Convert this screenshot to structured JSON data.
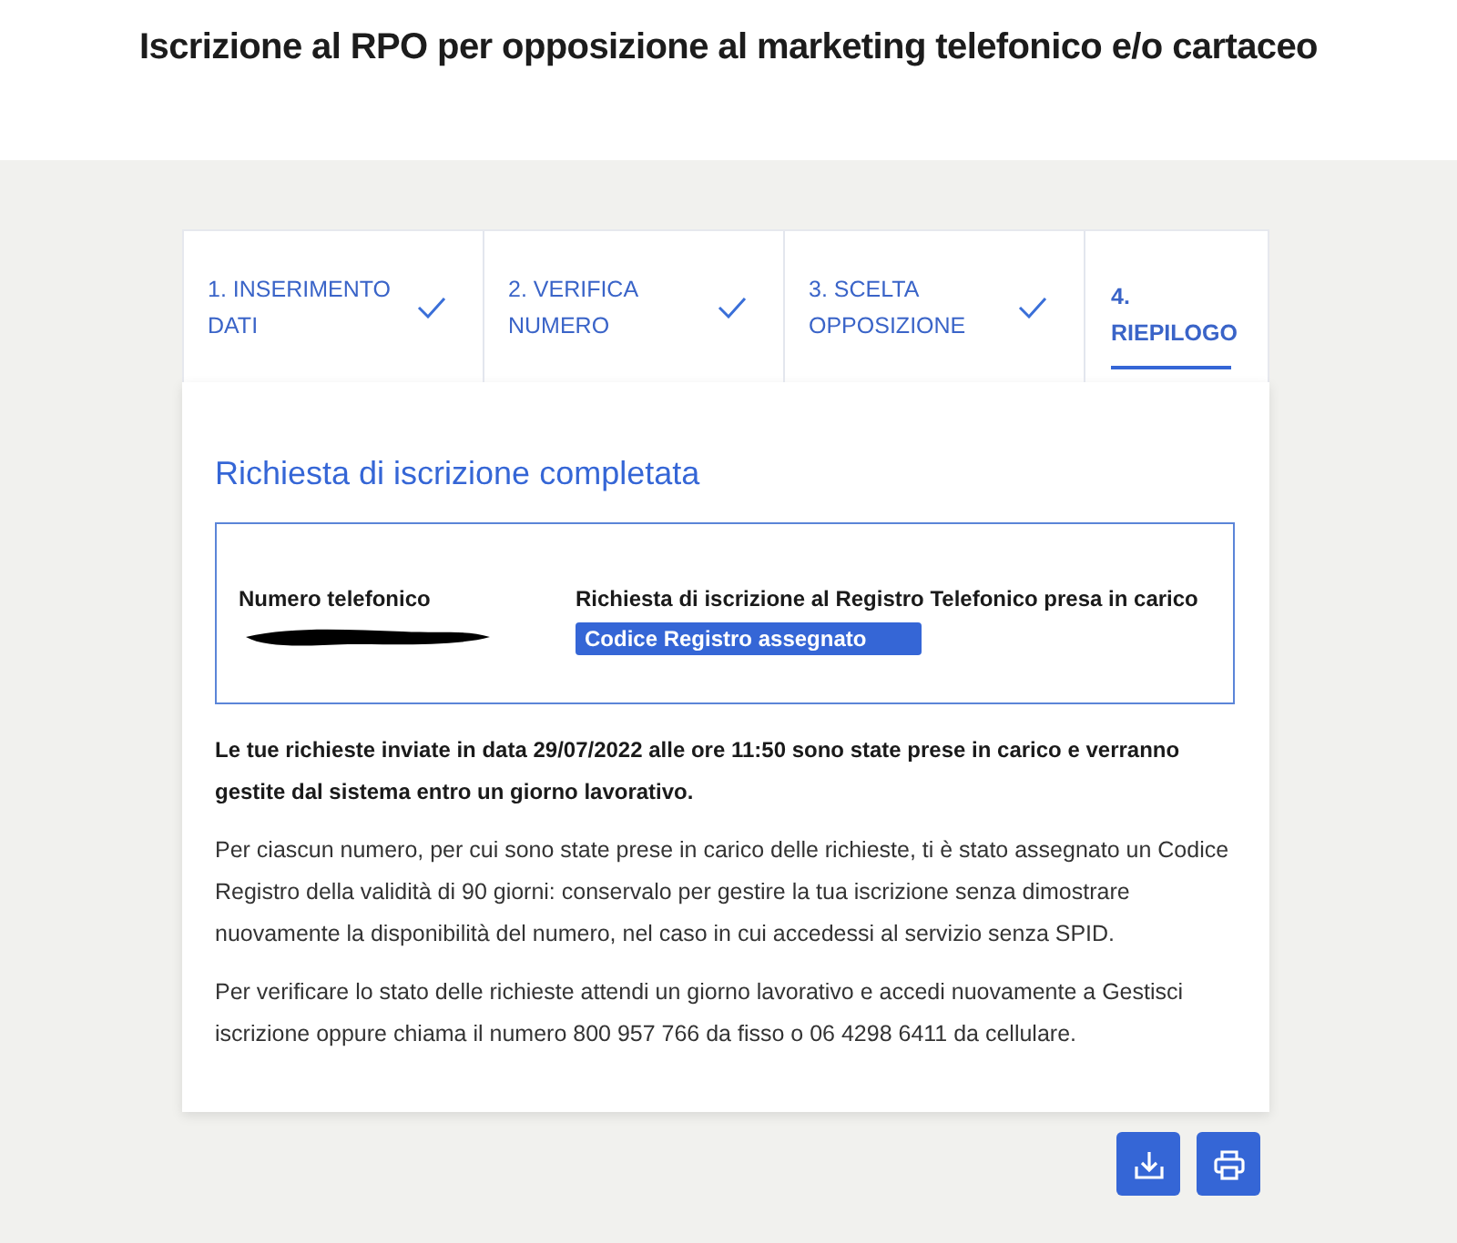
{
  "page_title": "Iscrizione al RPO per opposizione al marketing telefonico e/o cartaceo",
  "steps": [
    {
      "label": "1. INSERIMENTO DATI",
      "completed": true,
      "selected": false
    },
    {
      "label": "2. VERIFICA NUMERO",
      "completed": true,
      "selected": false
    },
    {
      "label": "3. SCELTA OPPOSIZIONE",
      "completed": true,
      "selected": false
    },
    {
      "label": "4. RIEPILOGO",
      "completed": false,
      "selected": true
    }
  ],
  "card": {
    "heading": "Richiesta di iscrizione completata",
    "summary": {
      "number_label": "Numero telefonico",
      "status_label": "Richiesta di iscrizione al Registro Telefonico presa in carico",
      "badge": "Codice Registro assegnato"
    },
    "notice": "Le tue richieste inviate in data 29/07/2022 alle ore 11:50 sono state prese in carico e verranno gestite dal sistema entro un giorno lavorativo.",
    "paragraphs": [
      "Per ciascun numero, per cui sono state prese in carico delle richieste, ti è stato assegnato un Codice Registro della validità di 90 giorni: conservalo per gestire la tua iscrizione senza dimostrare nuovamente la disponibilità del numero, nel caso in cui accedessi al servizio senza SPID.",
      "Per verificare lo stato delle richieste attendi un giorno lavorativo e accedi nuovamente a Gestisci iscrizione oppure chiama il numero 800 957 766 da fisso o 06 4298 6411 da cellulare."
    ]
  },
  "actions": [
    {
      "kind": "download"
    },
    {
      "kind": "print"
    }
  ]
}
